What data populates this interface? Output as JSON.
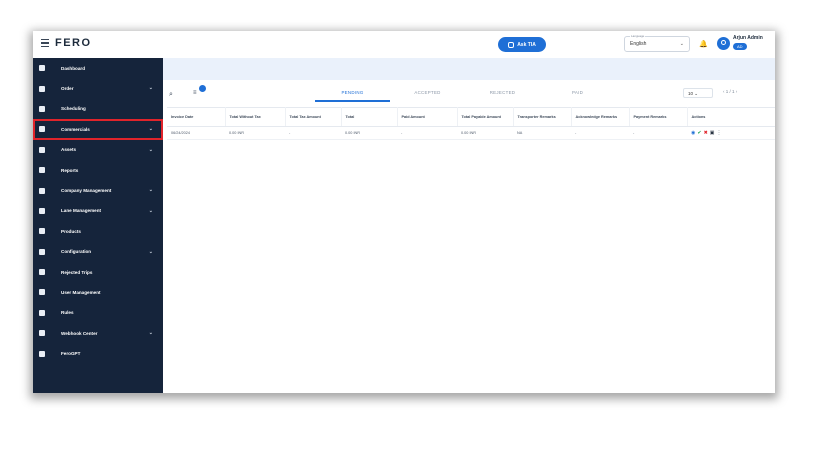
{
  "header": {
    "logo": "FERO",
    "ask_button": "Ask TIA",
    "language_label": "Language",
    "language_value": "English",
    "user_name": "Arjun Admin",
    "user_role": "AD"
  },
  "sidebar": {
    "items": [
      {
        "label": "Dashboard",
        "icon": "dashboard-icon",
        "chevron": false
      },
      {
        "label": "Order",
        "icon": "order-icon",
        "chevron": true
      },
      {
        "label": "Scheduling",
        "icon": "scheduling-icon",
        "chevron": false
      },
      {
        "label": "Commercials",
        "icon": "commercials-icon",
        "chevron": true
      },
      {
        "label": "Assets",
        "icon": "assets-icon",
        "chevron": true
      },
      {
        "label": "Reports",
        "icon": "reports-icon",
        "chevron": false
      },
      {
        "label": "Company Management",
        "icon": "company-icon",
        "chevron": true
      },
      {
        "label": "Lane Management",
        "icon": "lane-icon",
        "chevron": true
      },
      {
        "label": "Products",
        "icon": "products-icon",
        "chevron": false
      },
      {
        "label": "Configuration",
        "icon": "gear-icon",
        "chevron": true
      },
      {
        "label": "Rejected Trips",
        "icon": "rejected-icon",
        "chevron": false
      },
      {
        "label": "User Management",
        "icon": "users-icon",
        "chevron": false
      },
      {
        "label": "Rules",
        "icon": "rules-icon",
        "chevron": false
      },
      {
        "label": "Webhook Center",
        "icon": "webhook-icon",
        "chevron": true
      },
      {
        "label": "FeroGPT",
        "icon": "ferogpt-icon",
        "chevron": false
      }
    ],
    "highlighted": "Commercials"
  },
  "toolbar": {
    "tabs": [
      "PENDING",
      "ACCEPTED",
      "REJECTED",
      "PAID"
    ],
    "active_tab": "PENDING",
    "page_size": "10",
    "page_info": "1 / 1"
  },
  "table": {
    "columns": [
      "Invoice Date",
      "Total Without Tax",
      "Total Tax Amount",
      "Total",
      "Paid Amount",
      "Total Payable Amount",
      "Transporter Remarks",
      "Acknowledge Remarks",
      "Payment Remarks",
      "Actions"
    ],
    "rows": [
      [
        "06/24/2024",
        "0.00 INR",
        "-",
        "0.00 INR",
        "-",
        "0.00 INR",
        "NA",
        "-",
        "-"
      ]
    ]
  },
  "colors": {
    "sidebar_bg": "#15243b",
    "accent": "#1f6fd6",
    "highlight_border": "#e0242b"
  }
}
